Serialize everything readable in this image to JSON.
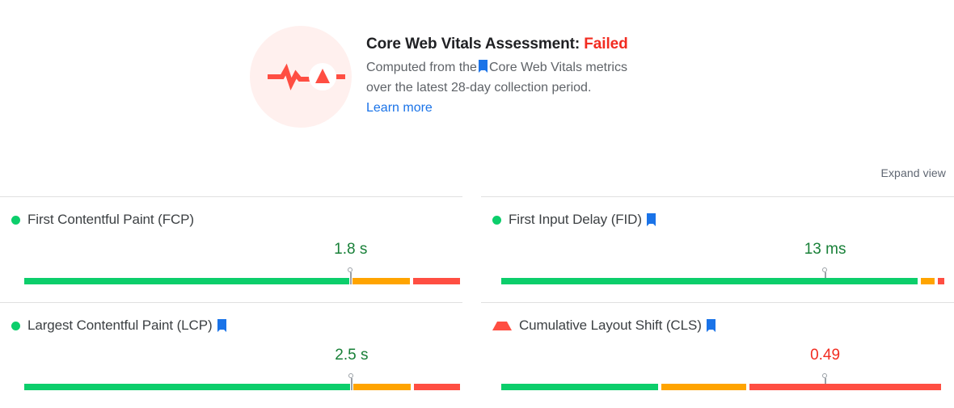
{
  "assessment": {
    "icon_name": "pulse-warning-icon",
    "title_prefix": "Core Web Vitals Assessment:",
    "verdict": "Failed",
    "verdict_color": "#f22c21",
    "desc_line1_a": "Computed from the",
    "desc_line1_b": "Core Web Vitals metrics",
    "desc_line2": "over the latest 28-day collection period.",
    "learn_more": "Learn more",
    "learn_more_color": "#1a73e8",
    "bookmark_icon": "bookmark-icon"
  },
  "toolbar": {
    "expand_view": "Expand view"
  },
  "colors": {
    "good": "#0cce6b",
    "needs_improvement": "#ffa400",
    "poor": "#ff4e42",
    "value_good_text": "#188038",
    "value_poor_text": "#f22c21",
    "divider": "#e0e0e0",
    "icon_bg": "#fff0ee"
  },
  "metrics": [
    {
      "id": "fcp",
      "label": "First Contentful Paint (FCP)",
      "status": "good",
      "status_icon": "green-circle-icon",
      "has_bookmark": false,
      "value": "1.8 s",
      "marker_percent": 74.5,
      "segments": [
        {
          "rating": "green",
          "percent": 74.2
        },
        {
          "rating": "orange",
          "percent": 13.1
        },
        {
          "rating": "red",
          "percent": 10.7
        }
      ]
    },
    {
      "id": "fid",
      "label": "First Input Delay (FID)",
      "status": "good",
      "status_icon": "green-circle-icon",
      "has_bookmark": true,
      "value": "13 ms",
      "marker_percent": 73.1,
      "segments": [
        {
          "rating": "green",
          "percent": 94.2
        },
        {
          "rating": "orange",
          "percent": 3.1
        },
        {
          "rating": "red",
          "percent": 1.4
        }
      ]
    },
    {
      "id": "lcp",
      "label": "Largest Contentful Paint (LCP)",
      "status": "good",
      "status_icon": "green-circle-icon",
      "has_bookmark": true,
      "value": "2.5 s",
      "marker_percent": 74.7,
      "segments": [
        {
          "rating": "green",
          "percent": 74.4
        },
        {
          "rating": "orange",
          "percent": 13.0
        },
        {
          "rating": "red",
          "percent": 10.6
        }
      ]
    },
    {
      "id": "cls",
      "label": "Cumulative Layout Shift (CLS)",
      "status": "poor",
      "status_icon": "red-triangle-icon",
      "has_bookmark": true,
      "value": "0.49",
      "marker_percent": 73.1,
      "segments": [
        {
          "rating": "green",
          "percent": 35.4
        },
        {
          "rating": "orange",
          "percent": 19.2
        },
        {
          "rating": "red",
          "percent": 43.2
        }
      ]
    }
  ]
}
